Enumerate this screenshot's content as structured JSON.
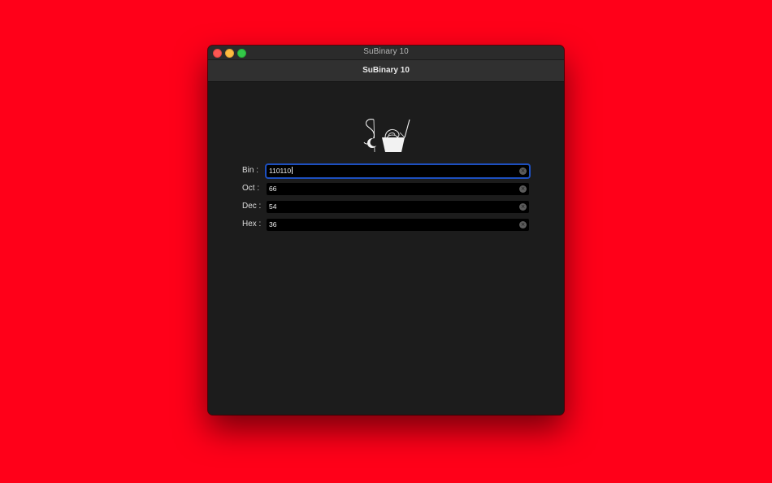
{
  "window": {
    "title": "SuBinary 10"
  },
  "toolbar": {
    "title": "SuBinary 10"
  },
  "logo": {
    "icon": "subinary-logo-icon"
  },
  "fields": [
    {
      "label": "Bin :",
      "value": "110110",
      "focused": true
    },
    {
      "label": "Oct :",
      "value": "66",
      "focused": false
    },
    {
      "label": "Dec :",
      "value": "54",
      "focused": false
    },
    {
      "label": "Hex :",
      "value": "36",
      "focused": false
    }
  ],
  "colors": {
    "background": "#ff0019",
    "window": "#1c1c1c",
    "focus_ring": "#1d4fbf"
  }
}
